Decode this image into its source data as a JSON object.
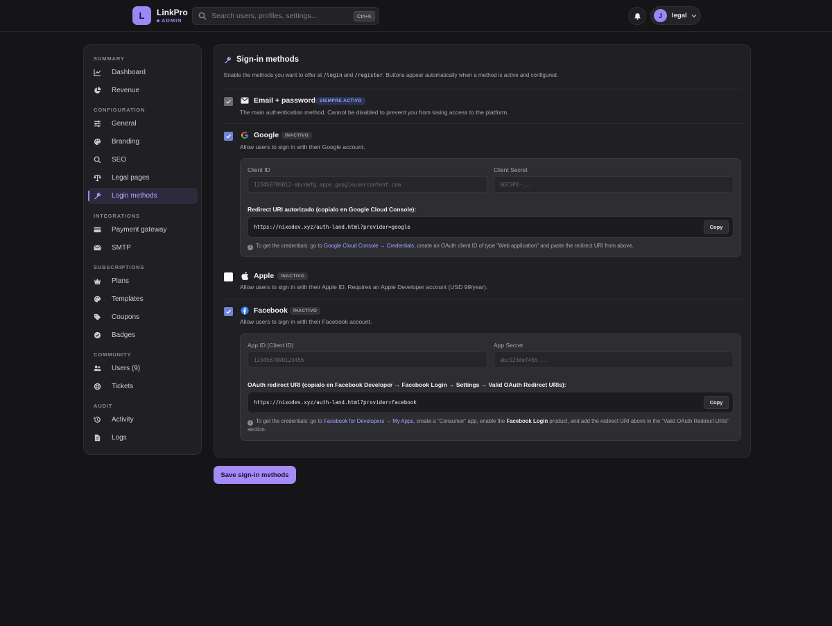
{
  "header": {
    "logo_letter": "L",
    "brand": "LinkPro",
    "brand_sub": "ADMIN",
    "search_placeholder": "Search users, profiles, settings...",
    "search_shortcut": "Ctrl+K",
    "avatar_letter": "J",
    "user": "legal"
  },
  "sidebar": {
    "sections": [
      {
        "title": "SUMMARY",
        "items": [
          {
            "label": "Dashboard",
            "icon": "chart-line-icon"
          },
          {
            "label": "Revenue",
            "icon": "pie-chart-icon"
          }
        ]
      },
      {
        "title": "CONFIGURATION",
        "items": [
          {
            "label": "General",
            "icon": "sliders-icon"
          },
          {
            "label": "Branding",
            "icon": "palette-icon"
          },
          {
            "label": "SEO",
            "icon": "search-icon"
          },
          {
            "label": "Legal pages",
            "icon": "scale-icon"
          },
          {
            "label": "Login methods",
            "icon": "key-icon",
            "active": true
          }
        ]
      },
      {
        "title": "INTEGRATIONS",
        "items": [
          {
            "label": "Payment gateway",
            "icon": "credit-card-icon"
          },
          {
            "label": "SMTP",
            "icon": "envelope-icon"
          }
        ]
      },
      {
        "title": "SUBSCRIPTIONS",
        "items": [
          {
            "label": "Plans",
            "icon": "crown-icon"
          },
          {
            "label": "Templates",
            "icon": "palette-icon"
          },
          {
            "label": "Coupons",
            "icon": "tag-icon"
          },
          {
            "label": "Badges",
            "icon": "check-badge-icon"
          }
        ]
      },
      {
        "title": "COMMUNITY",
        "items": [
          {
            "label": "Users (9)",
            "icon": "users-icon"
          },
          {
            "label": "Tickets",
            "icon": "lifebuoy-icon"
          }
        ]
      },
      {
        "title": "AUDIT",
        "items": [
          {
            "label": "Activity",
            "icon": "history-icon"
          },
          {
            "label": "Logs",
            "icon": "file-icon"
          }
        ]
      }
    ]
  },
  "panel": {
    "title": "Sign-in methods",
    "desc_1": "Enable the methods you want to offer at ",
    "desc_code_1": "/login",
    "desc_2": " and ",
    "desc_code_2": "/register",
    "desc_3": ". Buttons appear automatically when a method is active and configured."
  },
  "methods": {
    "email": {
      "name": "Email + password",
      "badge": "SIEMPRE ACTIVO",
      "desc": "The main authentication method. Cannot be disabled to prevent you from losing access to the platform.",
      "checked": true
    },
    "google": {
      "name": "Google",
      "badge": "INACTIVO",
      "desc": "Allow users to sign in with their Google account.",
      "checked": true,
      "client_id_label": "Client ID",
      "client_id_placeholder": "123456789012-abcdefg.apps.googleusercontent.com",
      "client_secret_label": "Client Secret",
      "client_secret_placeholder": "GOCSPX-...",
      "redirect_label": "Redirect URI autorizado (copialo en Google Cloud Console):",
      "redirect_uri": "https://nixodev.xyz/auth-land.html?provider=google",
      "copy": "Copy",
      "help_1": "To get the credentials: go to ",
      "help_link_1": "Google Cloud Console",
      "help_arrow": " → ",
      "help_link_2": "Credentials",
      "help_2": ", create an OAuth client ID of type \"Web application\" and paste the redirect URI from above."
    },
    "apple": {
      "name": "Apple",
      "badge": "INACTIVO",
      "desc": "Allow users to sign in with their Apple ID. Requires an Apple Developer account (USD 99/year).",
      "checked": false
    },
    "facebook": {
      "name": "Facebook",
      "badge": "INACTIVO",
      "desc": "Allow users to sign in with their Facebook account.",
      "checked": true,
      "app_id_label": "App ID (Client ID)",
      "app_id_placeholder": "1234567890123456",
      "app_secret_label": "App Secret",
      "app_secret_placeholder": "abc123def456...",
      "redirect_label": "OAuth redirect URI (copialo en Facebook Developer → Facebook Login → Settings → Valid OAuth Redirect URIs):",
      "redirect_uri": "https://nixodev.xyz/auth-land.html?provider=facebook",
      "copy": "Copy",
      "help_1": "To get the credentials: go to ",
      "help_link_1": "Facebook for Developers",
      "help_arrow": " → ",
      "help_link_2": "My Apps",
      "help_2": ", create a \"Consumer\" app, enable the ",
      "help_bold": "Facebook Login",
      "help_3": " product, and add the redirect URI above in the \"Valid OAuth Redirect URIs\" section."
    }
  },
  "save_button": "Save sign-in methods",
  "colors": {
    "accent": "#9d86f5",
    "checkbox": "#6f83d8",
    "link": "#9fa8ff",
    "background": "#151517",
    "card": "#202024"
  }
}
